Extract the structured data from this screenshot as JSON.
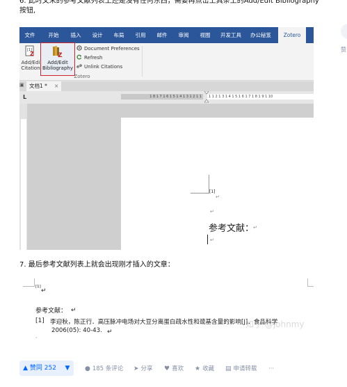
{
  "article": {
    "step6_line1": "6. 此时文末的参考文献列表上还是没有任何东西，需要再点击上具条上的Add/Edit Bibliography",
    "step6_line2": "按钮,",
    "step7": "7. 最后参考文献列表上就会出现刚才插入的文章："
  },
  "sidebar": {
    "like_label": "赞"
  },
  "word": {
    "tabs": [
      "文件",
      "开始",
      "插入",
      "设计",
      "布局",
      "引用",
      "邮件",
      "审阅",
      "视图",
      "开发工具",
      "办公秘笈",
      "Zotero"
    ],
    "active_tab": "Zotero",
    "ribbon": {
      "add_citation_line1": "Add/Edi",
      "add_citation_line2": "Citation",
      "add_bib_line1": "Add/Edit",
      "add_bib_line2": "Bibliography",
      "doc_prefs": "Document Preferences",
      "refresh": "Refresh",
      "unlink": "Unlink Citations",
      "group_label": "Zotero"
    },
    "doc_tab": "文档1 *",
    "ruler_left_nums": "1 8 1 7 1 6 1 5 1 4 1 3 1 2 1 1",
    "ruler_right_nums": "1 1 2 1 3 1 4 1 5 1 6 1 7 1 8 1 9 1 10",
    "ruler_left_marker": "L",
    "page": {
      "citation": "[1]",
      "heading": "参考文献：",
      "watermark": "知乎 @johnmy"
    }
  },
  "doc2": {
    "citation": "[1]",
    "heading": "参考文献：",
    "ref_num": "[1]",
    "ref_line1": "李迎秋，陈正行．高压脉冲电场对大豆分离蛋白疏水性和巯基含量的影响[J]．食品科学",
    "ref_line2": "2006(05): 40-43.",
    "watermark": "知乎 @johnmy"
  },
  "actions": {
    "upvote": "赞同 252",
    "comments": "185 条评论",
    "share": "分享",
    "like": "喜欢",
    "favorite": "收藏",
    "apply_repost": "申请转载",
    "more": "···"
  },
  "colors": {
    "ribbon_blue": "#2b579a",
    "highlight_red": "#d0232a",
    "zhihu_blue": "#0066ff"
  }
}
